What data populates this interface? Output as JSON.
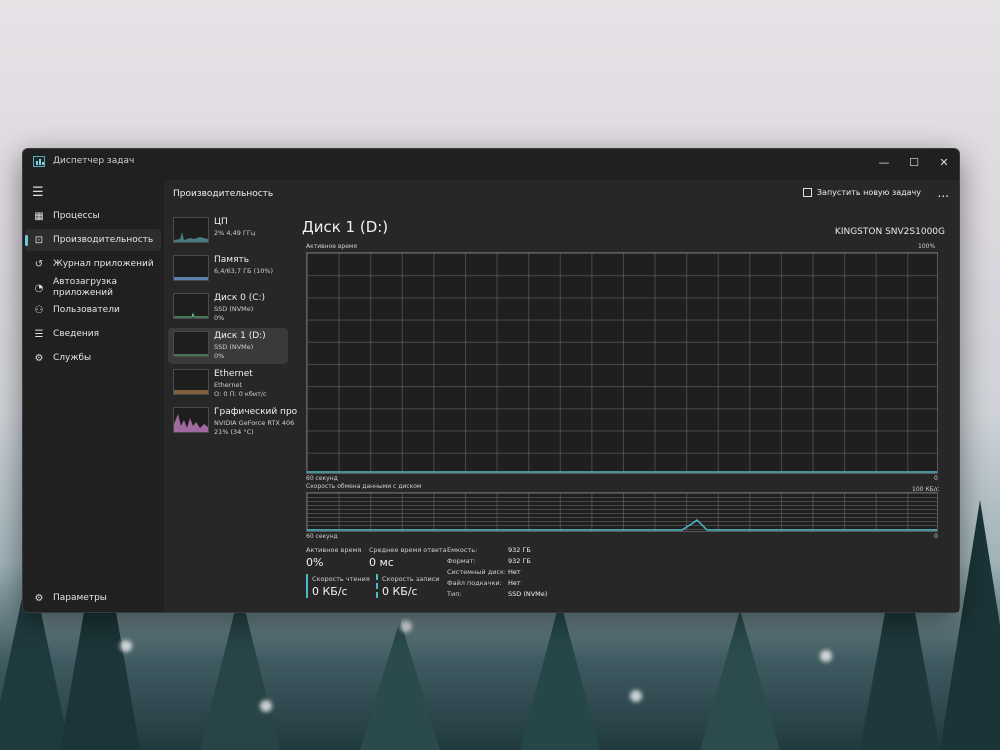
{
  "window": {
    "title": "Диспетчер задач",
    "controls": [
      "minimize-icon",
      "maximize-icon",
      "close-icon"
    ]
  },
  "nav": {
    "items": [
      {
        "label": "Процессы",
        "icon": "processes-icon"
      },
      {
        "label": "Производительность",
        "icon": "performance-icon",
        "active": true
      },
      {
        "label": "Журнал приложений",
        "icon": "history-icon"
      },
      {
        "label": "Автозагрузка приложений",
        "icon": "startup-icon"
      },
      {
        "label": "Пользователи",
        "icon": "users-icon"
      },
      {
        "label": "Сведения",
        "icon": "details-icon"
      },
      {
        "label": "Службы",
        "icon": "services-icon"
      }
    ],
    "settings_label": "Параметры"
  },
  "header": {
    "title": "Производительность",
    "run_task_label": "Запустить новую задачу",
    "more": "..."
  },
  "devices": [
    {
      "name": "ЦП",
      "sub1": "2% 4,49 ГГц",
      "sub2": "",
      "color": "#6fc6d6"
    },
    {
      "name": "Память",
      "sub1": "6,4/63,7 ГБ (10%)",
      "sub2": "",
      "color": "#7aa8e8"
    },
    {
      "name": "Диск 0 (C:)",
      "sub1": "SSD (NVMe)",
      "sub2": "0%",
      "color": "#6fcf8f"
    },
    {
      "name": "Диск 1 (D:)",
      "sub1": "SSD (NVMe)",
      "sub2": "0%",
      "color": "#6fcf8f",
      "active": true
    },
    {
      "name": "Ethernet",
      "sub1": "Ethernet",
      "sub2": "О: 0 П: 0 кбит/с",
      "color": "#c58a4f"
    },
    {
      "name": "Графический про",
      "sub1": "NVIDIA GeForce RTX 406",
      "sub2": "21% (34 °C)",
      "color": "#d58ad6"
    }
  ],
  "detail": {
    "title": "Диск 1 (D:)",
    "model": "KINGSTON SNV2S1000G",
    "graph1": {
      "label": "Активное время",
      "max": "100%",
      "time": "60 секунд",
      "min": "0"
    },
    "graph2": {
      "label": "Скорость обмена данными с диском",
      "max": "100 КБ/с",
      "time": "60 секунд",
      "min": "0"
    },
    "stats": {
      "active_time_label": "Активное время",
      "active_time_value": "0%",
      "avg_response_label": "Среднее время ответа",
      "avg_response_value": "0 мс",
      "read_label": "Скорость чтения",
      "read_value": "0 КБ/с",
      "write_label": "Скорость записи",
      "write_value": "0 КБ/с"
    },
    "props": [
      {
        "k": "Емкость:",
        "v": "932 ГБ"
      },
      {
        "k": "Формат:",
        "v": "932 ГБ"
      },
      {
        "k": "Системный диск:",
        "v": "Нет"
      },
      {
        "k": "Файл подкачки:",
        "v": "Нет"
      },
      {
        "k": "Тип:",
        "v": "SSD (NVMe)"
      }
    ]
  },
  "accent_color": "#4fb8c8"
}
